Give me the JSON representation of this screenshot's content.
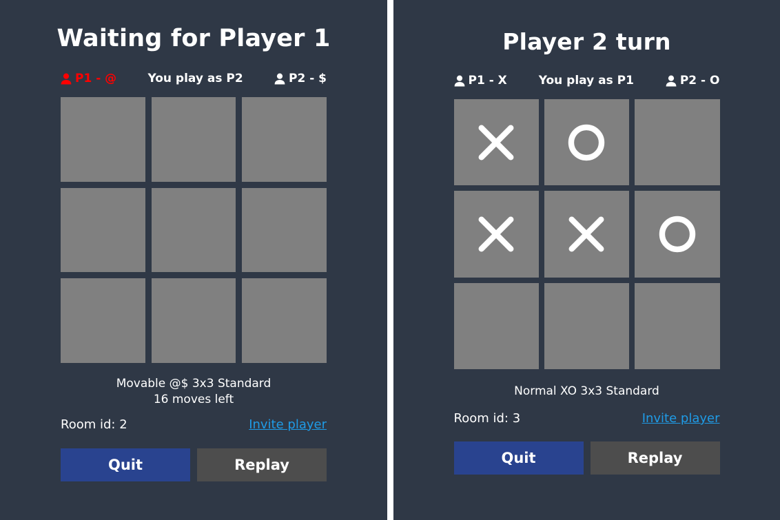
{
  "panels": [
    {
      "id": "left",
      "title": "Waiting for Player 1",
      "players": {
        "p1_label": "P1 - @",
        "p1_active": true,
        "you_play": "You play as P2",
        "p2_label": "P2 - $",
        "p2_active": false
      },
      "board": {
        "rows": 3,
        "cols": 3,
        "cells": [
          "",
          "",
          "",
          "",
          "",
          "",
          "",
          "",
          ""
        ]
      },
      "mode_text": "Movable @$ 3x3 Standard\n16 moves left",
      "room_id": "Room id: 2",
      "invite_label": "Invite player",
      "quit_label": "Quit",
      "replay_label": "Replay"
    },
    {
      "id": "right",
      "title": "Player 2 turn",
      "players": {
        "p1_label": "P1 - X",
        "p1_active": false,
        "you_play": "You play as P1",
        "p2_label": "P2 - O",
        "p2_active": false
      },
      "board": {
        "rows": 3,
        "cols": 3,
        "cells": [
          "X",
          "O",
          "",
          "X",
          "X",
          "O",
          "",
          "",
          ""
        ]
      },
      "mode_text": "Normal XO 3x3 Standard",
      "room_id": "Room id: 3",
      "invite_label": "Invite player",
      "quit_label": "Quit",
      "replay_label": "Replay"
    }
  ],
  "colors": {
    "background": "#2f3846",
    "cell": "#808080",
    "mark": "#ffffff",
    "accent_active": "#ff0000",
    "link": "#1f9be6",
    "quit_button": "#29438f",
    "replay_button": "#4d4d4d",
    "divider": "#ffffff"
  },
  "icons": {
    "person": "person-icon"
  }
}
